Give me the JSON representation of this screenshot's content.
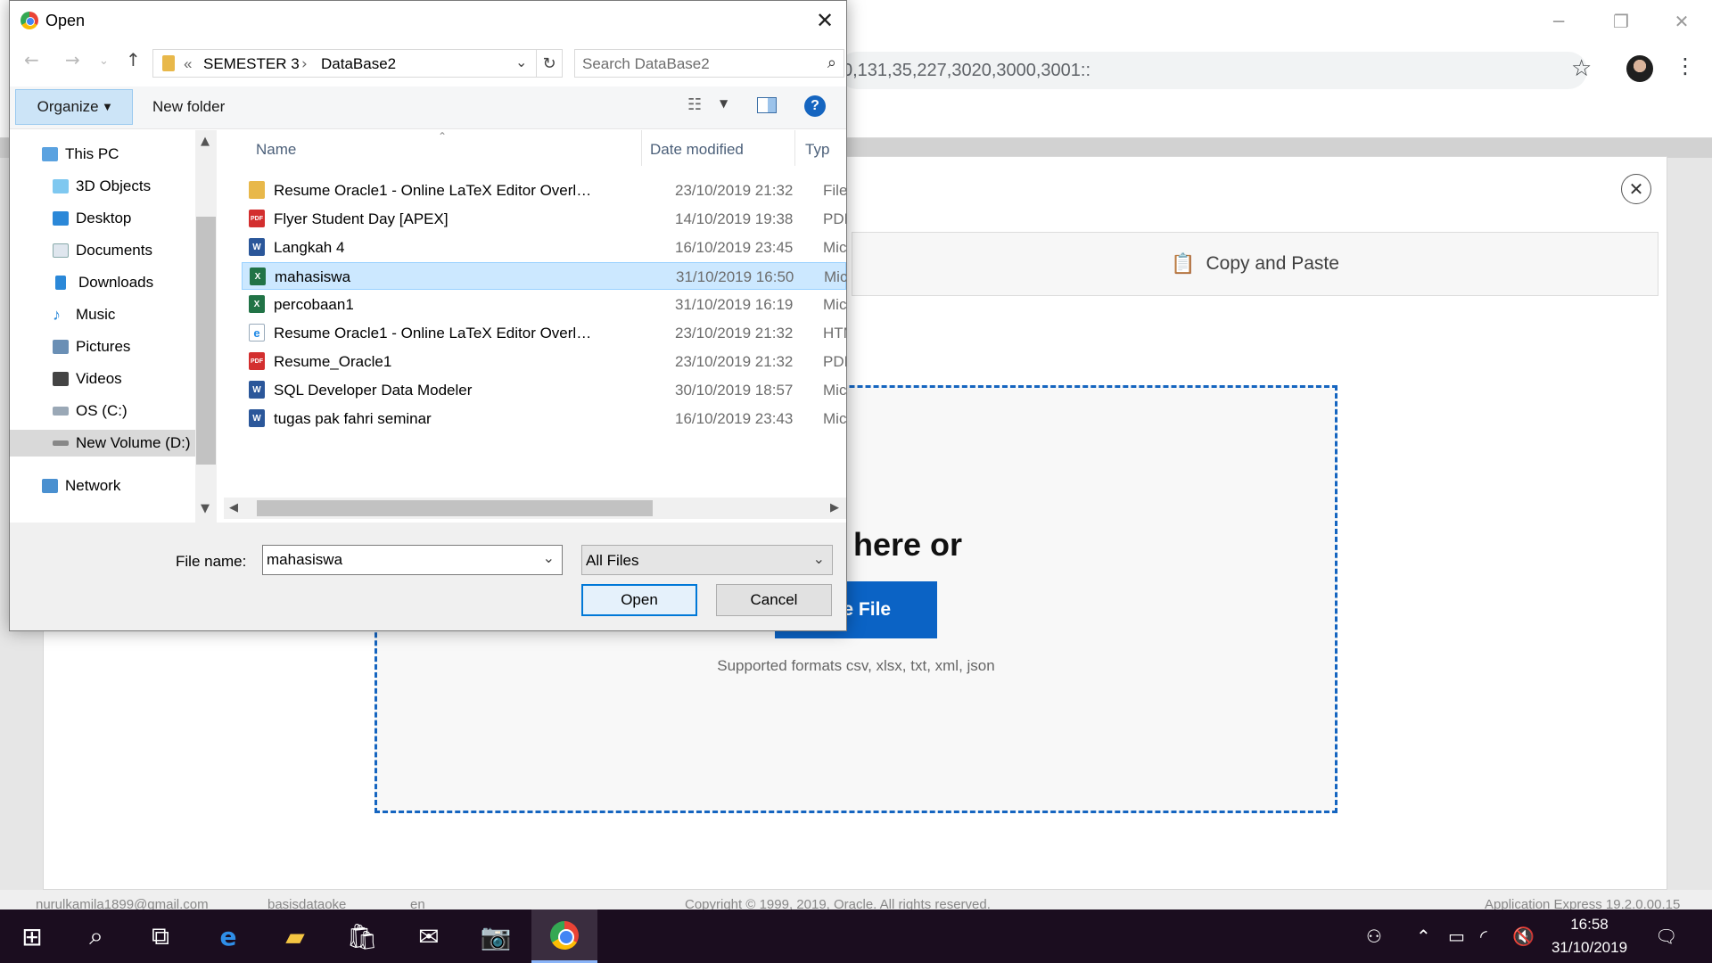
{
  "browser": {
    "omnibox_text": "0,131,35,227,3020,3000,3001::",
    "window_controls": [
      "minimize-icon",
      "restore-icon",
      "close-icon"
    ]
  },
  "apex": {
    "copy_paste_label": "Copy and Paste",
    "drop_text": "op file here or",
    "choose_file_label": "ose File",
    "formats_text": "Supported formats csv, xlsx, txt, xml, json",
    "footer": {
      "user": "nurulkamila1899@gmail.com",
      "workspace": "basisdataoke",
      "language": "en",
      "copyright": "Copyright © 1999, 2019, Oracle. All rights reserved.",
      "version": "Application Express 19.2.0.00.15"
    },
    "accent_color": "#0b63c5"
  },
  "dialog": {
    "title": "Open",
    "address": {
      "prefix": "«",
      "crumbs": [
        "SEMESTER 3",
        "DataBase2"
      ]
    },
    "search_placeholder": "Search DataBase2",
    "toolbar": {
      "organize_label": "Organize",
      "new_folder_label": "New folder"
    },
    "nav_items": [
      {
        "label": "This PC",
        "icon": "computer-icon"
      },
      {
        "label": "3D Objects",
        "icon": "3d-objects-icon"
      },
      {
        "label": "Desktop",
        "icon": "desktop-icon"
      },
      {
        "label": "Documents",
        "icon": "documents-icon"
      },
      {
        "label": "Downloads",
        "icon": "downloads-icon"
      },
      {
        "label": "Music",
        "icon": "music-icon"
      },
      {
        "label": "Pictures",
        "icon": "pictures-icon"
      },
      {
        "label": "Videos",
        "icon": "videos-icon"
      },
      {
        "label": "OS (C:)",
        "icon": "drive-c-icon"
      },
      {
        "label": "New Volume (D:)",
        "icon": "drive-d-icon"
      },
      {
        "label": "Network",
        "icon": "network-icon"
      }
    ],
    "columns": {
      "name": "Name",
      "date": "Date modified",
      "type": "Typ"
    },
    "files": [
      {
        "name": "Resume Oracle1 - Online LaTeX Editor Overleaf_...",
        "date": "23/10/2019 21:32",
        "type": "File",
        "icon": "folder-icon",
        "selected": false
      },
      {
        "name": "Flyer Student Day [APEX]",
        "date": "14/10/2019 19:38",
        "type": "PDF",
        "icon": "pdf-icon",
        "selected": false
      },
      {
        "name": "Langkah 4",
        "date": "16/10/2019 23:45",
        "type": "Mic",
        "icon": "word-icon",
        "selected": false
      },
      {
        "name": "mahasiswa",
        "date": "31/10/2019 16:50",
        "type": "Mic",
        "icon": "excel-icon",
        "selected": true
      },
      {
        "name": "percobaan1",
        "date": "31/10/2019 16:19",
        "type": "Mic",
        "icon": "excel-icon",
        "selected": false
      },
      {
        "name": "Resume Oracle1 - Online LaTeX Editor Overleaf",
        "date": "23/10/2019 21:32",
        "type": "HTM",
        "icon": "html-icon",
        "selected": false
      },
      {
        "name": "Resume_Oracle1",
        "date": "23/10/2019 21:32",
        "type": "PDF",
        "icon": "pdf-icon",
        "selected": false
      },
      {
        "name": "SQL Developer Data Modeler",
        "date": "30/10/2019 18:57",
        "type": "Mic",
        "icon": "word-icon",
        "selected": false
      },
      {
        "name": "tugas pak fahri seminar",
        "date": "16/10/2019 23:43",
        "type": "Mic",
        "icon": "word-icon",
        "selected": false
      }
    ],
    "filename_label": "File name:",
    "filename_value": "mahasiswa",
    "filter_value": "All Files",
    "open_label": "Open",
    "cancel_label": "Cancel"
  },
  "taskbar": {
    "time": "16:58",
    "date": "31/10/2019"
  }
}
